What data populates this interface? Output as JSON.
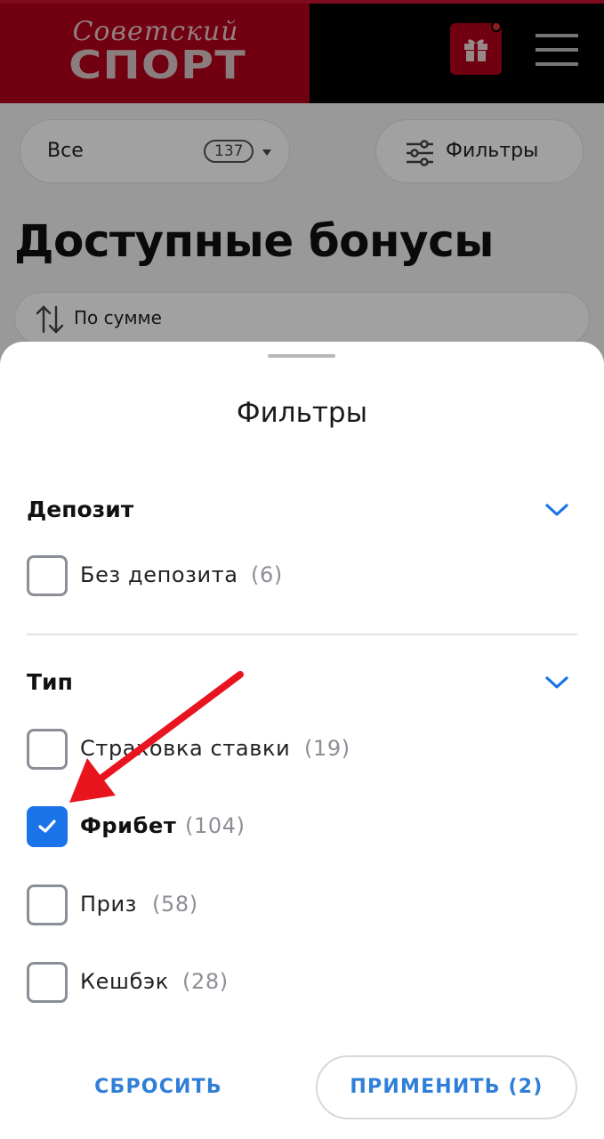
{
  "header": {
    "logo_top": "Советский",
    "logo_main": "СПОРТ",
    "icons": {
      "gift": "gift-icon",
      "menu": "hamburger-menu-icon"
    }
  },
  "page": {
    "filter_all": {
      "label": "Все",
      "count": "137"
    },
    "filter_button": {
      "label": "Фильтры"
    },
    "title": "Доступные бонусы",
    "sort": {
      "label": "По сумме"
    }
  },
  "sheet": {
    "title": "Фильтры",
    "sections": [
      {
        "title": "Депозит",
        "options": [
          {
            "label": "Без депозита",
            "count": "(6)",
            "checked": false
          }
        ]
      },
      {
        "title": "Тип",
        "options": [
          {
            "label": "Страховка ставки",
            "count": "(19)",
            "checked": false
          },
          {
            "label": "Фрибет",
            "count": "(104)",
            "checked": true
          },
          {
            "label": "Приз",
            "count": "(58)",
            "checked": false
          },
          {
            "label": "Кешбэк",
            "count": "(28)",
            "checked": false
          }
        ]
      }
    ],
    "reset_label": "СБРОСИТЬ",
    "apply_label": "ПРИМЕНИТЬ (2)"
  },
  "colors": {
    "brand_red": "#b3001b",
    "accent_blue": "#1a73e8",
    "annotation_arrow": "#e8141e"
  }
}
